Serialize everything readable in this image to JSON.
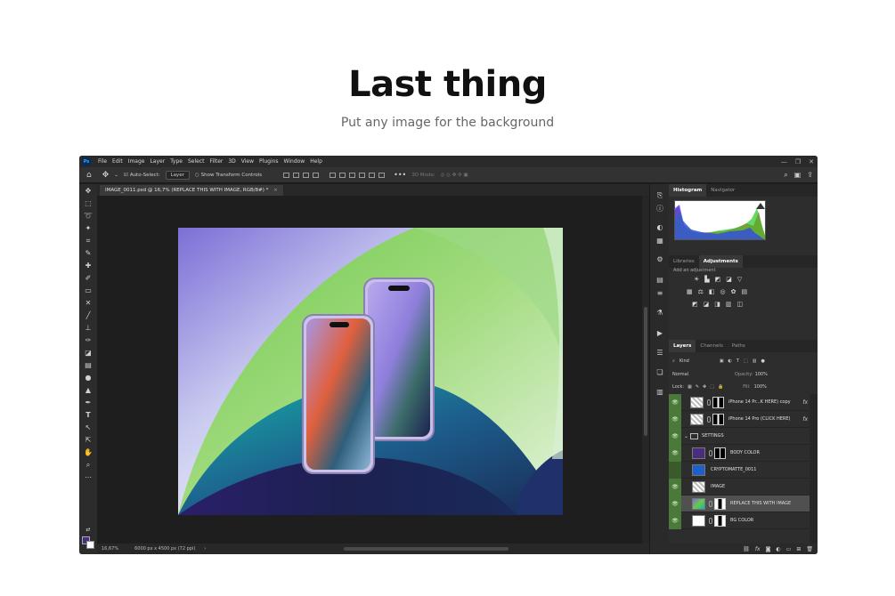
{
  "hero": {
    "title": "Last thing",
    "subtitle": "Put any image for the background"
  },
  "photoshop": {
    "logo": "Ps",
    "menu": [
      "File",
      "Edit",
      "Image",
      "Layer",
      "Type",
      "Select",
      "Filter",
      "3D",
      "View",
      "Plugins",
      "Window",
      "Help"
    ],
    "window_controls": [
      "—",
      "❐",
      "✕"
    ],
    "options_bar": {
      "auto_select_label": "Auto-Select:",
      "auto_select_value": "Layer",
      "transform_controls_label": "Show Transform Controls",
      "mode_3d_label": "3D Mode:"
    },
    "document_tab": "IMAGE_0011.psd @ 16,7% (REPLACE THIS WITH IMAGE, RGB/8#) *",
    "status": {
      "zoom": "16,67%",
      "doc_size": "6000 pх x 4500 pх (72 ppi)"
    },
    "panels": {
      "histogram_tabs": [
        "Histogram",
        "Navigator"
      ],
      "adjust_tabs": [
        "Libraries",
        "Adjustments"
      ],
      "add_adjustment": "Add an adjustment",
      "layers_tabs": [
        "Layers",
        "Channels",
        "Paths"
      ],
      "filter_kind": "Kind",
      "blend_mode": "Normal",
      "opacity_label": "Opacity:",
      "opacity_value": "100%",
      "lock_label": "Lock:",
      "fill_label": "Fill:",
      "fill_value": "100%"
    },
    "layers": [
      {
        "name": "iPhone 14 Pr...K HERE) copy",
        "visible": true,
        "fx": "fx"
      },
      {
        "name": "iPhone 14 Pro (CLICK HERE)",
        "visible": true,
        "fx": "fx"
      },
      {
        "name": "SETTINGS",
        "visible": true
      },
      {
        "name": "BODY COLOR",
        "visible": true
      },
      {
        "name": "CRYPTOMATTE_0011",
        "visible": false
      },
      {
        "name": "IMAGE",
        "visible": true
      },
      {
        "name": "REPLACE THIS WITH IMAGE",
        "visible": true,
        "selected": true
      },
      {
        "name": "BG COLOR",
        "visible": true
      }
    ],
    "colors": {
      "foreground": "#4b2d7f",
      "background": "#ffffff"
    }
  }
}
